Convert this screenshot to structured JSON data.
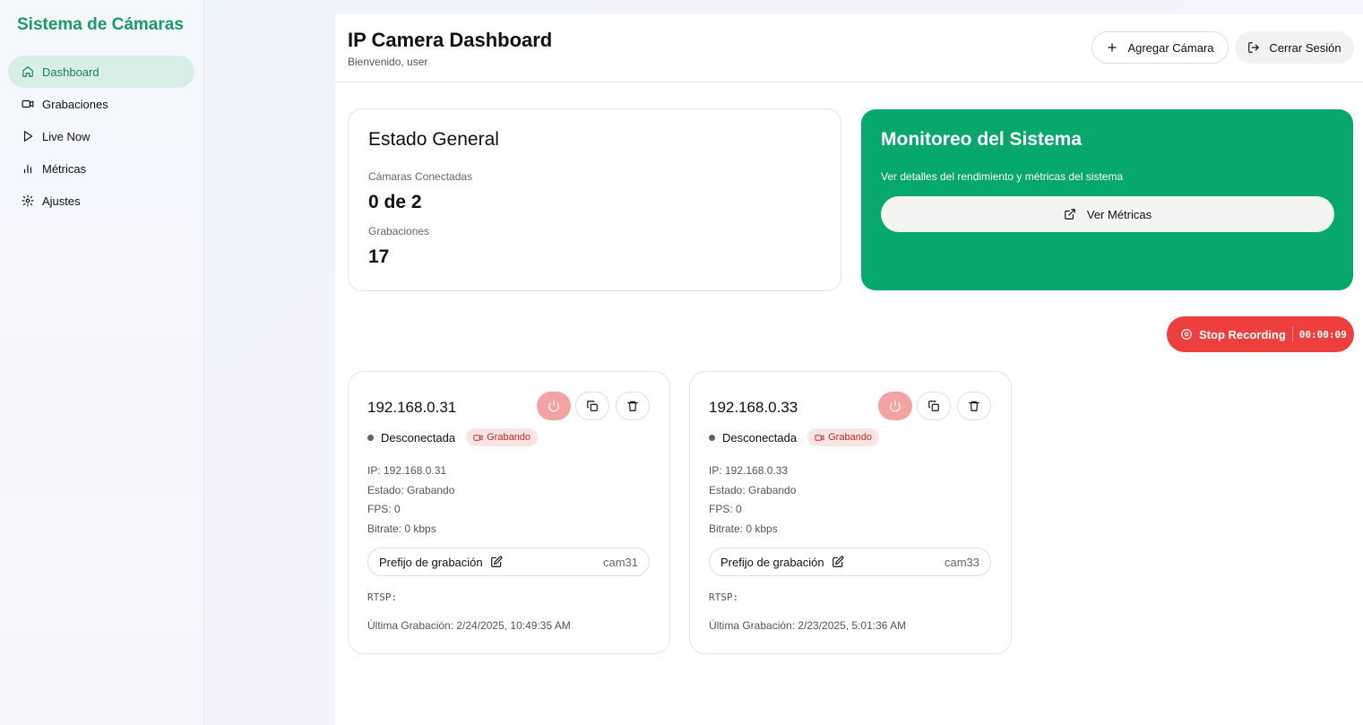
{
  "sidebar": {
    "brand": "Sistema de Cámaras",
    "items": [
      {
        "label": "Dashboard",
        "icon": "home-icon",
        "active": true
      },
      {
        "label": "Grabaciones",
        "icon": "video-icon",
        "active": false
      },
      {
        "label": "Live Now",
        "icon": "play-icon",
        "active": false
      },
      {
        "label": "Métricas",
        "icon": "bar-chart-icon",
        "active": false
      },
      {
        "label": "Ajustes",
        "icon": "gear-icon",
        "active": false
      }
    ]
  },
  "header": {
    "title": "IP Camera Dashboard",
    "subtitle": "Bienvenido, user",
    "add_camera_label": "Agregar Cámara",
    "logout_label": "Cerrar Sesión"
  },
  "estado": {
    "title": "Estado General",
    "connected_label": "Cámaras Conectadas",
    "connected_value": "0 de 2",
    "recordings_label": "Grabaciones",
    "recordings_value": "17"
  },
  "monitor": {
    "title": "Monitoreo del Sistema",
    "description": "Ver detalles del rendimiento y métricas del sistema",
    "button_label": "Ver Métricas",
    "color": "#07a86b"
  },
  "recording": {
    "stop_label": "Stop Recording",
    "timer": "00:00:09",
    "color": "#ee3f3f"
  },
  "cameras": [
    {
      "title": "192.168.0.31",
      "status": "Desconectada",
      "badge": "Grabando",
      "ip": "IP: 192.168.0.31",
      "estado": "Estado: Grabando",
      "fps": "FPS: 0",
      "bitrate": "Bitrate: 0 kbps",
      "prefix_label": "Prefijo de grabación",
      "prefix_value": "cam31",
      "rtsp": "RTSP:",
      "last_recording": "Última Grabación: 2/24/2025, 10:49:35 AM"
    },
    {
      "title": "192.168.0.33",
      "status": "Desconectada",
      "badge": "Grabando",
      "ip": "IP: 192.168.0.33",
      "estado": "Estado: Grabando",
      "fps": "FPS: 0",
      "bitrate": "Bitrate: 0 kbps",
      "prefix_label": "Prefijo de grabación",
      "prefix_value": "cam33",
      "rtsp": "RTSP:",
      "last_recording": "Última Grabación: 2/23/2025, 5:01:36 AM"
    }
  ]
}
